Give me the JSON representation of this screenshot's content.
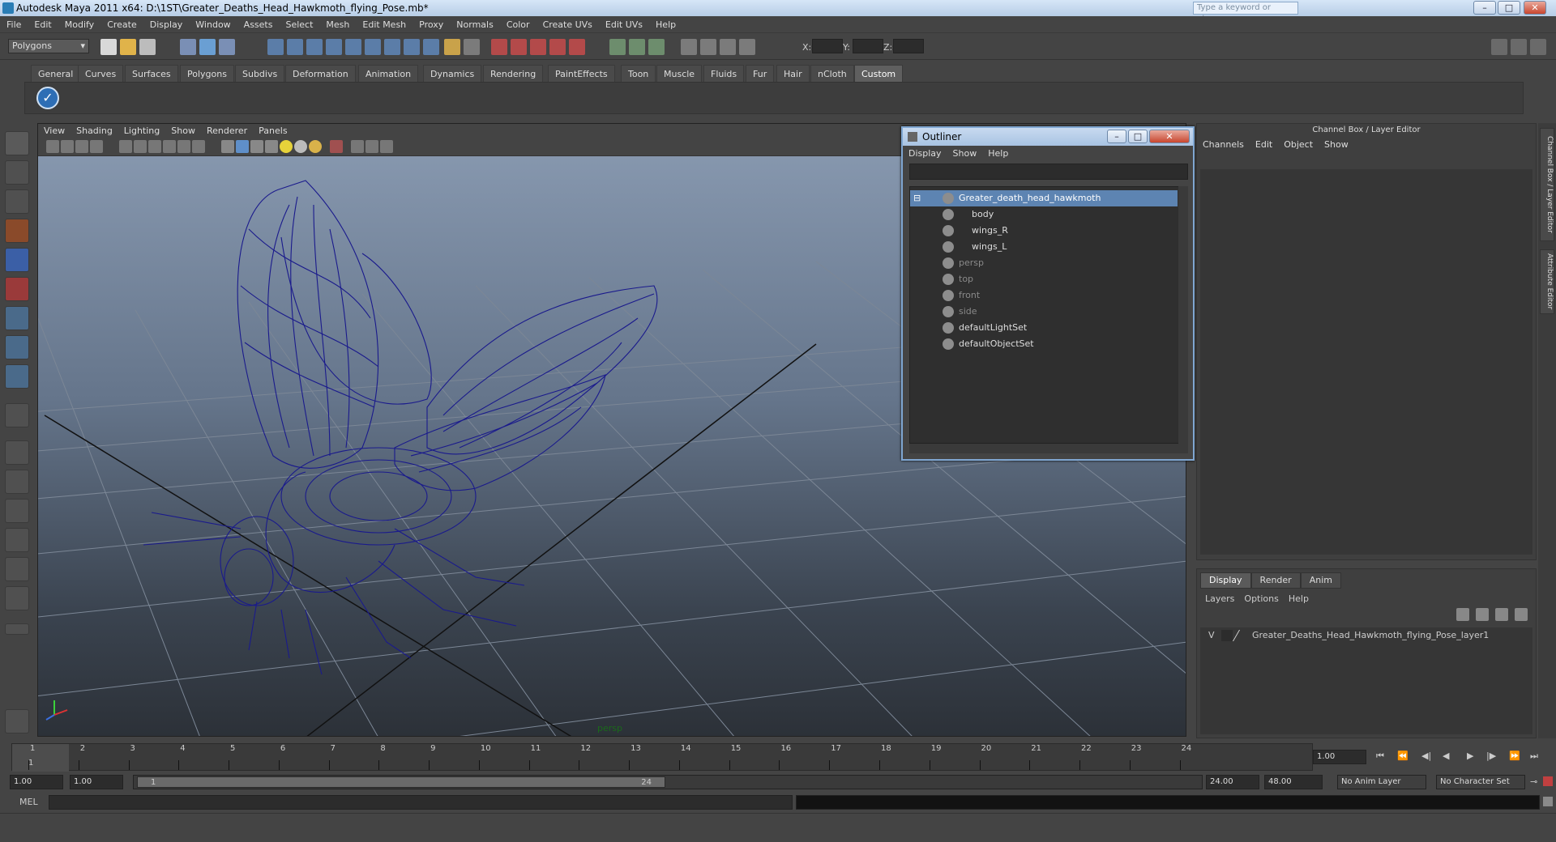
{
  "titlebar": {
    "title": "Autodesk Maya 2011 x64: D:\\1ST\\Greater_Deaths_Head_Hawkmoth_flying_Pose.mb*",
    "search_placeholder": "Type a keyword or phrase"
  },
  "menu": [
    "File",
    "Edit",
    "Modify",
    "Create",
    "Display",
    "Window",
    "Assets",
    "Select",
    "Mesh",
    "Edit Mesh",
    "Proxy",
    "Normals",
    "Color",
    "Create UVs",
    "Edit UVs",
    "Help"
  ],
  "status": {
    "mode": "Polygons",
    "x_label": "X:",
    "y_label": "Y:",
    "z_label": "Z:"
  },
  "shelf_tabs": [
    "General",
    "Curves",
    "Surfaces",
    "Polygons",
    "Subdivs",
    "Deformation",
    "Animation",
    "Dynamics",
    "Rendering",
    "PaintEffects",
    "Toon",
    "Muscle",
    "Fluids",
    "Fur",
    "Hair",
    "nCloth",
    "Custom"
  ],
  "shelf_active": "Custom",
  "viewport": {
    "menu": [
      "View",
      "Shading",
      "Lighting",
      "Show",
      "Renderer",
      "Panels"
    ],
    "camera": "persp"
  },
  "outliner": {
    "title": "Outliner",
    "menu": [
      "Display",
      "Show",
      "Help"
    ],
    "rows": [
      {
        "label": "Greater_death_head_hawkmoth",
        "indent": 0,
        "highlight": true,
        "dim": false
      },
      {
        "label": "body",
        "indent": 1,
        "highlight": false,
        "dim": false
      },
      {
        "label": "wings_R",
        "indent": 1,
        "highlight": false,
        "dim": false
      },
      {
        "label": "wings_L",
        "indent": 1,
        "highlight": false,
        "dim": false
      },
      {
        "label": "persp",
        "indent": 0,
        "highlight": false,
        "dim": true
      },
      {
        "label": "top",
        "indent": 0,
        "highlight": false,
        "dim": true
      },
      {
        "label": "front",
        "indent": 0,
        "highlight": false,
        "dim": true
      },
      {
        "label": "side",
        "indent": 0,
        "highlight": false,
        "dim": true
      },
      {
        "label": "defaultLightSet",
        "indent": 0,
        "highlight": false,
        "dim": false
      },
      {
        "label": "defaultObjectSet",
        "indent": 0,
        "highlight": false,
        "dim": false
      }
    ]
  },
  "channel_box": {
    "header": "Channel Box / Layer Editor",
    "menu": [
      "Channels",
      "Edit",
      "Object",
      "Show"
    ]
  },
  "layer_editor": {
    "tabs": [
      "Display",
      "Render",
      "Anim"
    ],
    "menu": [
      "Layers",
      "Options",
      "Help"
    ],
    "layer_vis": "V",
    "layer_name": "Greater_Deaths_Head_Hawkmoth_flying_Pose_layer1"
  },
  "side_tabs": [
    "Channel Box / Layer Editor",
    "Attribute Editor"
  ],
  "timeline": {
    "ticks": [
      "1",
      "2",
      "3",
      "4",
      "5",
      "6",
      "7",
      "8",
      "9",
      "10",
      "11",
      "12",
      "13",
      "14",
      "15",
      "16",
      "17",
      "18",
      "19",
      "20",
      "21",
      "22",
      "23",
      "24"
    ],
    "current": "1",
    "current_field": "1.00"
  },
  "range": {
    "start": "1.00",
    "start2": "1.00",
    "slider_start": "1",
    "slider_end": "24",
    "end": "24.00",
    "end2": "48.00",
    "anim_layer": "No Anim Layer",
    "char_set": "No Character Set"
  },
  "cmd": {
    "label": "MEL"
  }
}
